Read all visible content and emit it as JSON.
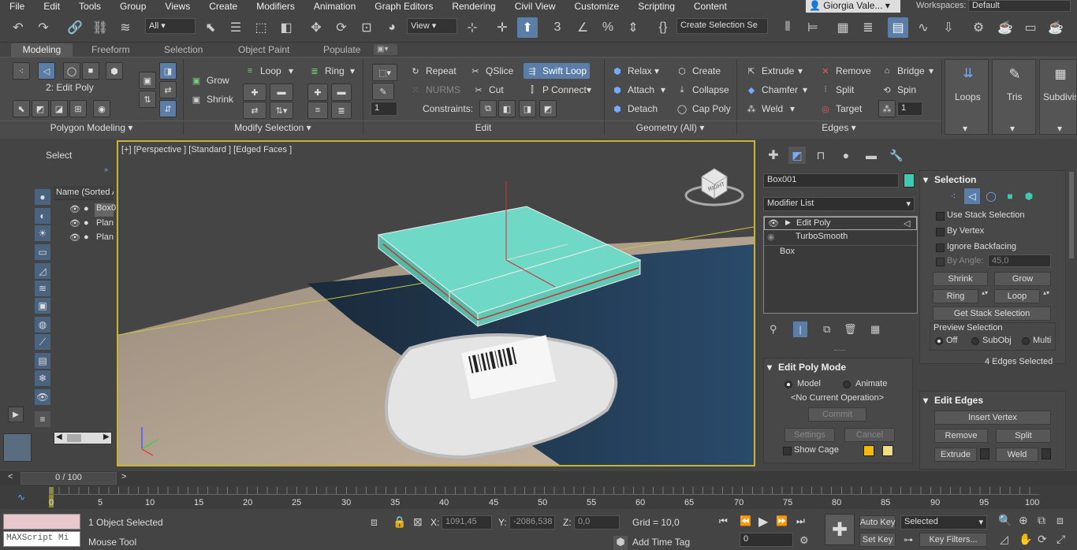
{
  "menu": [
    "File",
    "Edit",
    "Tools",
    "Group",
    "Views",
    "Create",
    "Modifiers",
    "Animation",
    "Graph Editors",
    "Rendering",
    "Civil View",
    "Customize",
    "Scripting",
    "Content"
  ],
  "user": "Giorgia Vale...",
  "workspaces_label": "Workspaces:",
  "workspace_value": "Default",
  "toolbar": {
    "filter": "All",
    "view": "View",
    "selection_set": "Create Selection Se"
  },
  "ribbon_tabs": [
    "Modeling",
    "Freeform",
    "Selection",
    "Object Paint",
    "Populate"
  ],
  "ribbon": {
    "edit_poly_level": "2: Edit Poly",
    "grow": "Grow",
    "shrink": "Shrink",
    "loop": "Loop",
    "ring": "Ring",
    "repeat": "Repeat",
    "qslice": "QSlice",
    "swift_loop": "Swift Loop",
    "nurms": "NURMS",
    "cut": "Cut",
    "p_connect": "P Connect",
    "constraints": "Constraints:",
    "spinner_value": "1",
    "relax": "Relax",
    "create": "Create",
    "attach": "Attach",
    "collapse": "Collapse",
    "detach": "Detach",
    "cap_poly": "Cap Poly",
    "extrude": "Extrude",
    "remove": "Remove",
    "bridge": "Bridge",
    "chamfer": "Chamfer",
    "split": "Split",
    "spin": "Spin",
    "weld": "Weld",
    "target": "Target",
    "edges_spinner": "1",
    "loops": "Loops",
    "tris": "Tris",
    "subdivision": "Subdivis",
    "panels": [
      "Polygon Modeling",
      "Modify Selection",
      "Edit",
      "Geometry (All)",
      "Edges"
    ]
  },
  "scene": {
    "select": "Select",
    "column": "Name (Sorted A",
    "items": [
      "Box0",
      "Plan",
      "Plan"
    ]
  },
  "viewport": {
    "label": "[+] [Perspective ] [Standard ] [Edged Faces ]",
    "cube_label": "RIGHT"
  },
  "cmd": {
    "object_name": "Box001",
    "modifier_list": "Modifier List",
    "stack": [
      "Edit Poly",
      "TurboSmooth",
      "Box"
    ],
    "selection": {
      "title": "Selection",
      "use_stack": "Use Stack Selection",
      "by_vertex": "By Vertex",
      "ignore_backfacing": "Ignore Backfacing",
      "by_angle": "By Angle:",
      "angle_value": "45,0",
      "shrink": "Shrink",
      "grow": "Grow",
      "ring": "Ring",
      "loop": "Loop",
      "get_stack": "Get Stack Selection",
      "preview": "Preview Selection",
      "off": "Off",
      "subobj": "SubObj",
      "multi": "Multi",
      "count": "4 Edges Selected"
    },
    "edit_poly_mode": {
      "title": "Edit Poly Mode",
      "model": "Model",
      "animate": "Animate",
      "current_op": "<No Current Operation>",
      "commit": "Commit",
      "settings": "Settings",
      "cancel": "Cancel",
      "show_cage": "Show Cage"
    },
    "edit_edges": {
      "title": "Edit Edges",
      "insert_vertex": "Insert Vertex",
      "remove": "Remove",
      "split": "Split",
      "extrude": "Extrude",
      "weld": "Weld"
    }
  },
  "timeline": {
    "frame": "0 / 100",
    "ticks": [
      "0",
      "5",
      "10",
      "15",
      "20",
      "25",
      "30",
      "35",
      "40",
      "45",
      "50",
      "55",
      "60",
      "65",
      "70",
      "75",
      "80",
      "85",
      "90",
      "95",
      "100"
    ]
  },
  "status": {
    "maxscript": "MAXScript Mi",
    "selected": "1 Object Selected",
    "mouse_tool": "Mouse Tool",
    "x_label": "X:",
    "x_value": "1091,45",
    "y_label": "Y:",
    "y_value": "-2086,538",
    "z_label": "Z:",
    "z_value": "0,0",
    "grid": "Grid = 10,0",
    "add_time_tag": "Add Time Tag",
    "auto_key": "Auto Key",
    "set_key": "Set Key",
    "selected_dd": "Selected",
    "key_filters": "Key Filters...",
    "frame_input": "0"
  },
  "colors": {
    "object_swatch": "#3fc9b0",
    "selection_accent": "#5a7ea8",
    "viewport_border": "#c8b433"
  }
}
